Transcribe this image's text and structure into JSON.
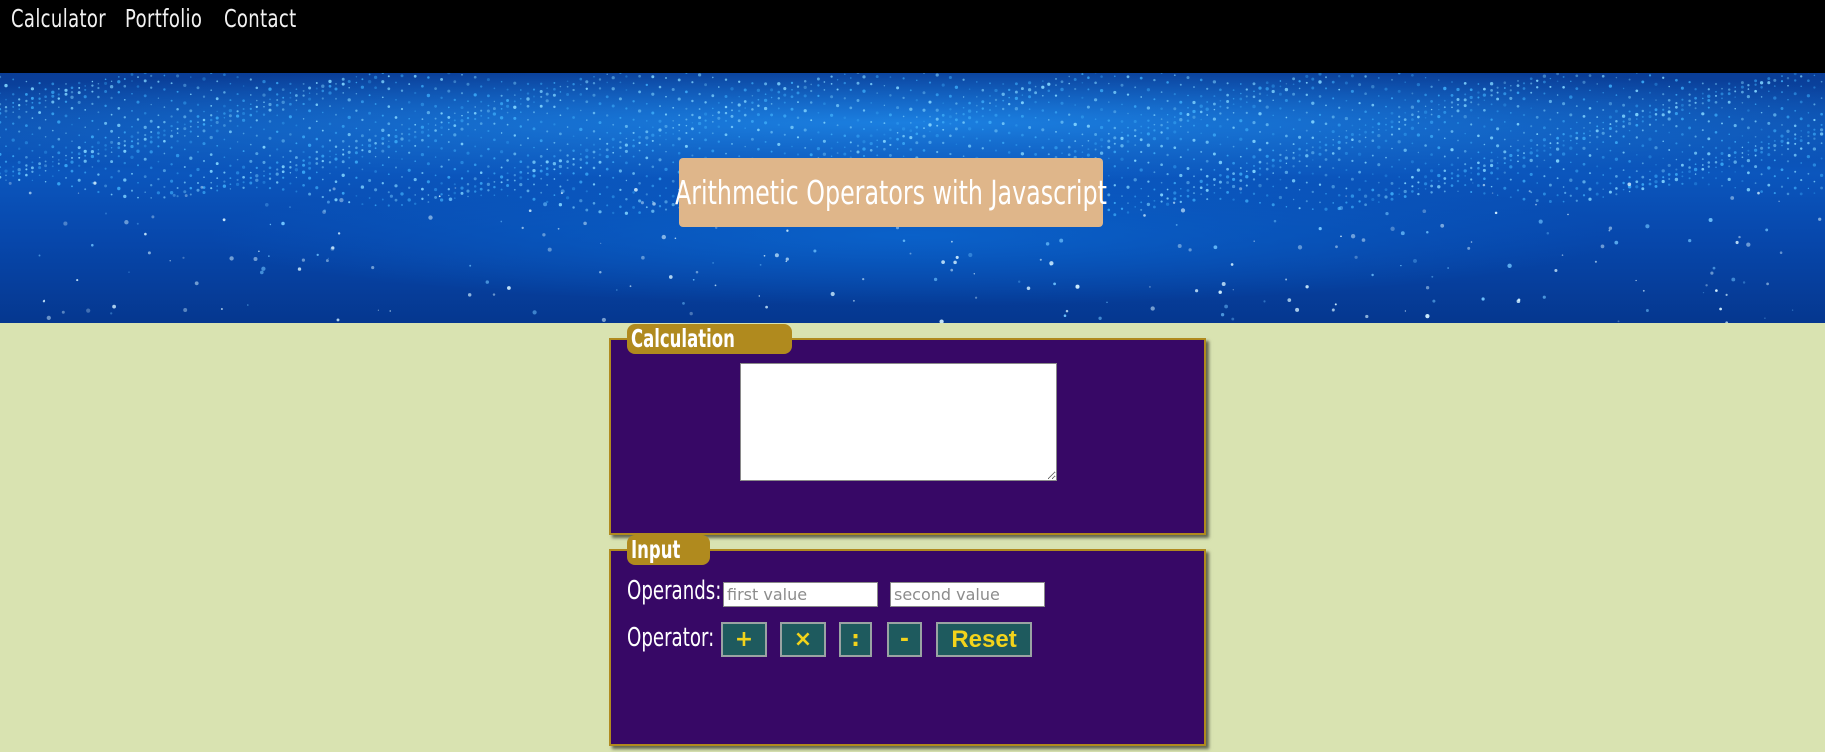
{
  "nav": {
    "items": [
      {
        "label": "Calculator"
      },
      {
        "label": "Portfolio"
      },
      {
        "label": "Contact"
      }
    ]
  },
  "hero": {
    "title": "Arithmetic Operators with Javascript"
  },
  "calculation_panel": {
    "legend": "Calculation",
    "output_value": ""
  },
  "input_panel": {
    "legend": "Input",
    "operands_label": "Operands:",
    "first_placeholder": "first value",
    "second_placeholder": "second value",
    "operator_label": "Operator:",
    "buttons": {
      "add": "+",
      "multiply": "×",
      "divide": ":",
      "subtract": "-",
      "reset": "Reset"
    }
  },
  "colors": {
    "nav_bg": "#000000",
    "page_bg": "#d9e3b1",
    "hero_title_bg": "#dfb68a",
    "panel_bg": "#370866",
    "panel_border": "#b08a1e",
    "button_bg": "#1e5a5e",
    "button_text": "#f2d31b"
  }
}
